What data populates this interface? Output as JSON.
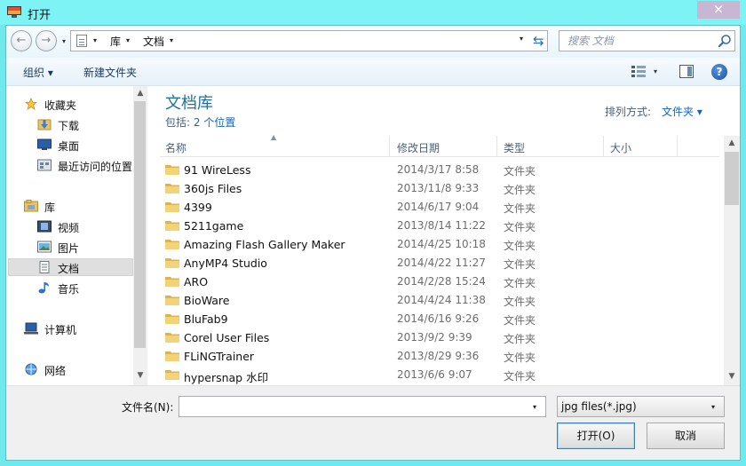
{
  "window": {
    "title": "打开",
    "close_label": "×"
  },
  "nav": {
    "back_label": "←",
    "forward_label": "→",
    "history_drop": "▾"
  },
  "address": {
    "segments": [
      "库",
      "文档"
    ],
    "sep": "▾",
    "drop": "▾",
    "refresh_label": "⇆"
  },
  "search": {
    "placeholder": "搜索 文档"
  },
  "toolbar": {
    "organize_label": "组织 ▾",
    "new_folder_label": "新建文件夹",
    "view_drop": "▾",
    "help_label": "?"
  },
  "sidebar": {
    "items": [
      {
        "label": "收藏夹",
        "icon": "star-icon"
      },
      {
        "label": "下载",
        "icon": "download-icon"
      },
      {
        "label": "桌面",
        "icon": "desktop-icon"
      },
      {
        "label": "最近访问的位置",
        "icon": "recent-places-icon"
      },
      {
        "label": "库",
        "icon": "libraries-icon"
      },
      {
        "label": "视频",
        "icon": "video-icon"
      },
      {
        "label": "图片",
        "icon": "pictures-icon"
      },
      {
        "label": "文档",
        "icon": "documents-icon",
        "selected": true
      },
      {
        "label": "音乐",
        "icon": "music-icon"
      },
      {
        "label": "计算机",
        "icon": "computer-icon"
      },
      {
        "label": "网络",
        "icon": "network-icon"
      }
    ],
    "scroll_up": "▲",
    "scroll_down": "▼"
  },
  "library": {
    "title": "文档库",
    "includes_label": "包括:",
    "includes_link": "2 个位置",
    "arrange_label": "排列方式:",
    "arrange_value": "文件夹 ▾"
  },
  "columns": {
    "name": "名称",
    "date": "修改日期",
    "type": "类型",
    "size": "大小",
    "sort_indicator": "▲"
  },
  "files": [
    {
      "name": "91 WireLess",
      "date": "2014/3/17 8:58",
      "type": "文件夹"
    },
    {
      "name": "360js Files",
      "date": "2013/11/8 9:33",
      "type": "文件夹"
    },
    {
      "name": "4399",
      "date": "2014/6/17 9:04",
      "type": "文件夹"
    },
    {
      "name": "5211game",
      "date": "2013/8/14 11:22",
      "type": "文件夹"
    },
    {
      "name": "Amazing Flash Gallery Maker",
      "date": "2014/4/25 10:18",
      "type": "文件夹"
    },
    {
      "name": "AnyMP4 Studio",
      "date": "2014/4/22 11:27",
      "type": "文件夹"
    },
    {
      "name": "ARO",
      "date": "2014/2/28 15:24",
      "type": "文件夹"
    },
    {
      "name": "BioWare",
      "date": "2014/4/24 11:38",
      "type": "文件夹"
    },
    {
      "name": "BluFab9",
      "date": "2014/6/16 9:26",
      "type": "文件夹"
    },
    {
      "name": "Corel User Files",
      "date": "2013/9/2 9:39",
      "type": "文件夹"
    },
    {
      "name": "FLiNGTrainer",
      "date": "2013/8/29 9:36",
      "type": "文件夹"
    },
    {
      "name": "hypersnap 水印",
      "date": "2013/6/6 9:07",
      "type": "文件夹"
    }
  ],
  "filescroll": {
    "up": "▲",
    "down": "▼"
  },
  "bottom": {
    "filename_label": "文件名(N):",
    "filename_value": "",
    "filename_drop": "▾",
    "filetype_value": "jpg files(*.jpg)",
    "filetype_drop": "▾",
    "open_label": "打开(O)",
    "cancel_label": "取消"
  }
}
